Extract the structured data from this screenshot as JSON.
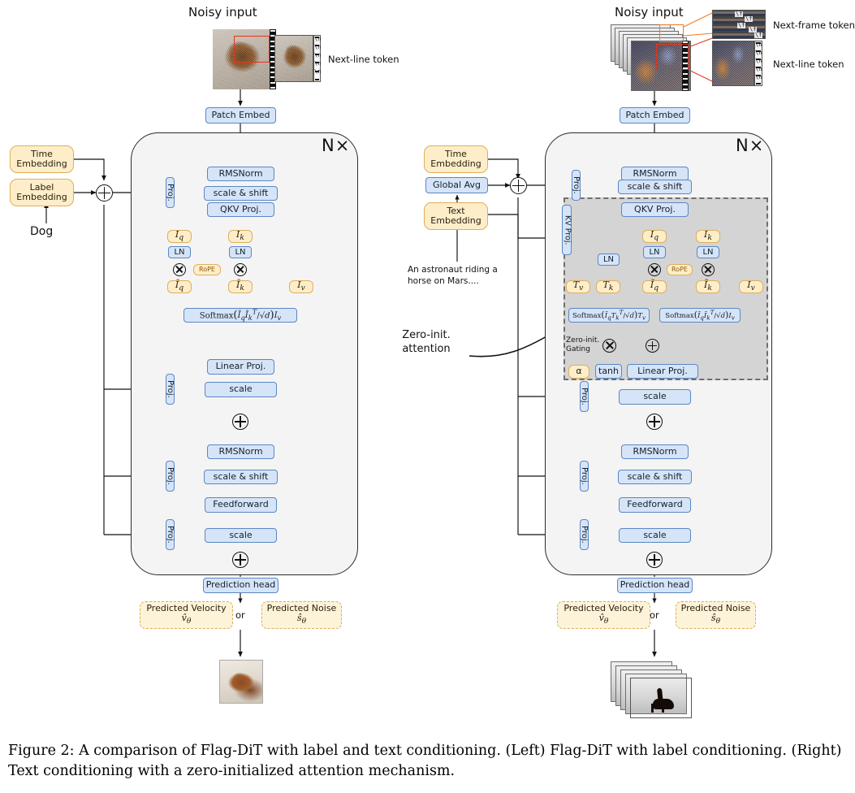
{
  "figure": {
    "caption": "Figure 2: A comparison of Flag-DiT with label and text conditioning. (Left) Flag-DiT with label conditioning. (Right) Text conditioning with a zero-initialized attention mechanism."
  },
  "colors": {
    "blue_fill": "#d6e4f7",
    "blue_border": "#5b87c4",
    "yellow_fill": "#fdeec9",
    "yellow_border": "#e0ae5a",
    "dashed_yellow_fill": "#fdf3d8",
    "block_fill": "#f4f4f4",
    "zero_block_fill": "#d4d4d4",
    "zero_block_border": "#6f6f6f",
    "red_crop": "#e8341c",
    "orange_crop": "#f07a21"
  },
  "left_panel": {
    "name": "Flag-DiT with label conditioning",
    "input_title": "Noisy input",
    "callout_label": "Next-line token",
    "token_glyph": "\\n",
    "patch_embed": "Patch Embed",
    "repeat_badge": "N×",
    "conditioning": {
      "time_embedding": "Time\nEmbedding",
      "time_embedding_line1": "Time",
      "time_embedding_line2": "Embedding",
      "label_embedding_line1": "Label",
      "label_embedding_line2": "Embedding",
      "class_prompt": "Dog",
      "sum_operator": "plus"
    },
    "blocks": {
      "rmsnorm_1": "RMSNorm",
      "scale_shift_1": "scale & shift",
      "qkv_proj": "QKV Proj.",
      "proj_1": "Proj.",
      "proj_2": "Proj.",
      "proj_3": "Proj.",
      "proj_4": "Proj.",
      "linear_proj": "Linear Proj.",
      "scale_1": "scale",
      "rmsnorm_2": "RMSNorm",
      "scale_shift_2": "scale & shift",
      "feedforward": "Feedforward",
      "scale_2": "scale",
      "prediction_head": "Prediction head"
    },
    "attention": {
      "tok_iq": "I_q",
      "tok_ik": "I_k",
      "tok_iv": "I_v",
      "ln_left": "LN",
      "ln_right": "LN",
      "rope": "RoPE",
      "tok_iq_tilde": "Ĩ_q",
      "tok_ik_tilde": "Ĩ_k",
      "softmax": "Softmax( Ĩq Ĩkᵀ / √d ) Iv"
    },
    "outputs": {
      "velocity_title": "Predicted Velocity",
      "velocity_symbol": "v̂θ",
      "or": "or",
      "noise_title": "Predicted Noise",
      "noise_symbol": "ŝθ"
    }
  },
  "right_panel": {
    "name": "Text conditioning with zero-initialized attention",
    "input_title": "Noisy input",
    "callout_frame_label": "Next-frame token",
    "callout_line_label": "Next-line token",
    "frame_token_glyph": "\\f",
    "line_token_glyph": "\\n",
    "patch_embed": "Patch Embed",
    "repeat_badge": "N×",
    "conditioning": {
      "time_embedding_line1": "Time",
      "time_embedding_line2": "Embedding",
      "global_avg": "Global Avg",
      "text_embedding_line1": "Text",
      "text_embedding_line2": "Embedding",
      "text_prompt_line1": "An astronaut riding a",
      "text_prompt_line2": "horse on Mars....",
      "sum_operator": "plus"
    },
    "annotation": {
      "line1": "Zero-init.",
      "line2": "attention"
    },
    "blocks": {
      "rmsnorm_1": "RMSNorm",
      "scale_shift_1": "scale & shift",
      "qkv_proj": "QKV Proj.",
      "kv_proj": "KV Proj.",
      "proj_1": "Proj.",
      "proj_2": "Proj.",
      "proj_3": "Proj.",
      "proj_4": "Proj.",
      "linear_proj": "Linear Proj.",
      "scale_1": "scale",
      "rmsnorm_2": "RMSNorm",
      "scale_shift_2": "scale & shift",
      "feedforward": "Feedforward",
      "scale_2": "scale",
      "prediction_head": "Prediction head"
    },
    "attention": {
      "ln_text": "LN",
      "tok_tv": "T_v",
      "tok_tk": "T_k",
      "tok_iq": "I_q",
      "tok_ik": "I_k",
      "tok_iv": "I_v",
      "ln_left": "LN",
      "ln_right": "LN",
      "rope": "RoPE",
      "tok_iq_tilde": "Ĩ_q",
      "tok_ik_tilde": "Ĩ_k",
      "softmax_cross": "Softmax( Ĩq Tkᵀ / √d ) Tv",
      "softmax_self": "Softmax( Ĩq Ĩkᵀ / √d ) Iv",
      "gating_line1": "Zero-init.",
      "gating_line2": "Gating",
      "alpha": "α",
      "tanh": "tanh"
    },
    "outputs": {
      "velocity_title": "Predicted Velocity",
      "velocity_symbol": "v̂θ",
      "or": "or",
      "noise_title": "Predicted Noise",
      "noise_symbol": "ŝθ"
    }
  }
}
